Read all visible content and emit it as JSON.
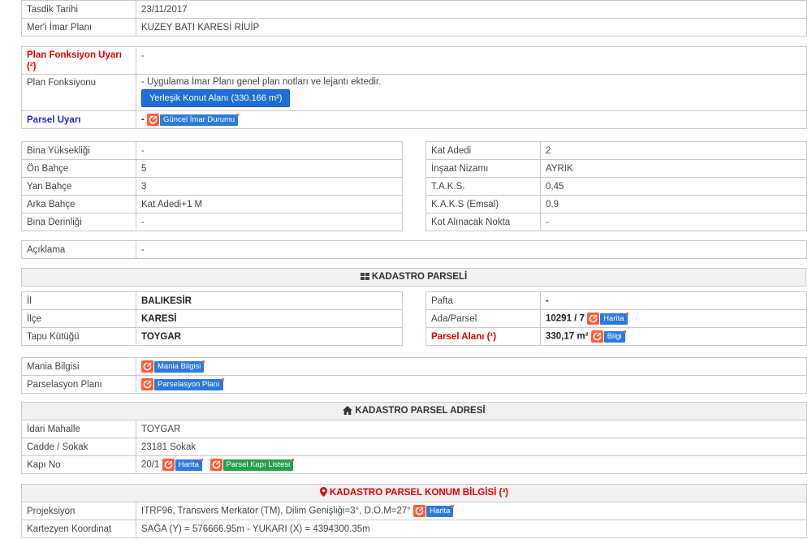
{
  "top": {
    "rows": [
      {
        "label": "Tasdik Tarihi",
        "value": "23/11/2017"
      },
      {
        "label": "Mer'i İmar Planı",
        "value": "KUZEY BATI KARESİ RİUİP"
      }
    ]
  },
  "plan": {
    "warning_label": "Plan Fonksiyon Uyarı (²)",
    "warning_value": "-",
    "function_label": "Plan Fonksiyonu",
    "function_text": "- Uygulama İmar Planı genel plan notları ve lejantı ektedir.",
    "function_button": "Yerleşik Konut Alanı (330.166 m²)",
    "parcel_warning_label": "Parsel Uyarı",
    "parcel_warning_value": "-",
    "guncel_link": "Güncel İmar Durumu"
  },
  "building": {
    "left": [
      {
        "label": "Bina Yüksekliği",
        "value": "-"
      },
      {
        "label": "Ön Bahçe",
        "value": "5"
      },
      {
        "label": "Yan Bahçe",
        "value": "3"
      },
      {
        "label": "Arka Bahçe",
        "value": "Kat Adedi+1 M"
      },
      {
        "label": "Bina Derinliği",
        "value": "-"
      }
    ],
    "right": [
      {
        "label": "Kat Adedi",
        "value": "2"
      },
      {
        "label": "İnşaat Nizamı",
        "value": "AYRIK"
      },
      {
        "label": "T.A.K.S.",
        "value": "0,45"
      },
      {
        "label": "K.A.K.S (Emsal)",
        "value": "0,9"
      },
      {
        "label": "Kot Alınacak Nokta",
        "value": "-"
      }
    ]
  },
  "aciklama": {
    "label": "Açıklama",
    "value": "-"
  },
  "kadastro": {
    "header": "KADASTRO PARSELİ",
    "left": [
      {
        "label": "İl",
        "value": "BALIKESİR"
      },
      {
        "label": "İlçe",
        "value": "KARESİ"
      },
      {
        "label": "Tapu Kütüğü",
        "value": "TOYGAR"
      }
    ],
    "pafta_label": "Pafta",
    "pafta_value": "-",
    "ada_label": "Ada/Parsel",
    "ada_value": "10291 / 7",
    "alan_label": "Parsel Alanı (¹)",
    "alan_value": "330,17 m²",
    "harita_link": "Harita",
    "bilgi_link": "Bilgi"
  },
  "mania": {
    "mania_label": "Mania Bilgisi",
    "mania_link": "Mania Bilgisi",
    "parselasyon_label": "Parselasyon Planı",
    "parselasyon_link": "Parselasyon Planı"
  },
  "adres": {
    "header": "KADASTRO PARSEL ADRESİ",
    "rows": [
      {
        "label": "İdari Mahalle",
        "value": "TOYGAR"
      },
      {
        "label": "Cadde / Sokak",
        "value": "23181 Sokak"
      }
    ],
    "kapi_label": "Kapı No",
    "kapi_value": "20/1",
    "harita_link": "Harita",
    "kapi_listesi_link": "Parsel Kapı Listesi"
  },
  "konum": {
    "header": "KADASTRO PARSEL KONUM BİLGİSİ (³)",
    "projeksiyon_label": "Projeksiyon",
    "projeksiyon_value": "ITRF96, Transvers Merkator (TM), Dilim Genişliği=3°, D.O.M=27°",
    "harita_link": "Harita",
    "kartezyen_label": "Kartezyen Koordinat",
    "kartezyen_value": "SAĞA (Y) = 576666.95m - YUKARI (X) = 4394300.35m"
  },
  "colors": {
    "accent_blue": "#1f6fd6",
    "warning_red": "#e00000",
    "link_orange": "#ff5b35",
    "link_green": "#24a04a"
  }
}
